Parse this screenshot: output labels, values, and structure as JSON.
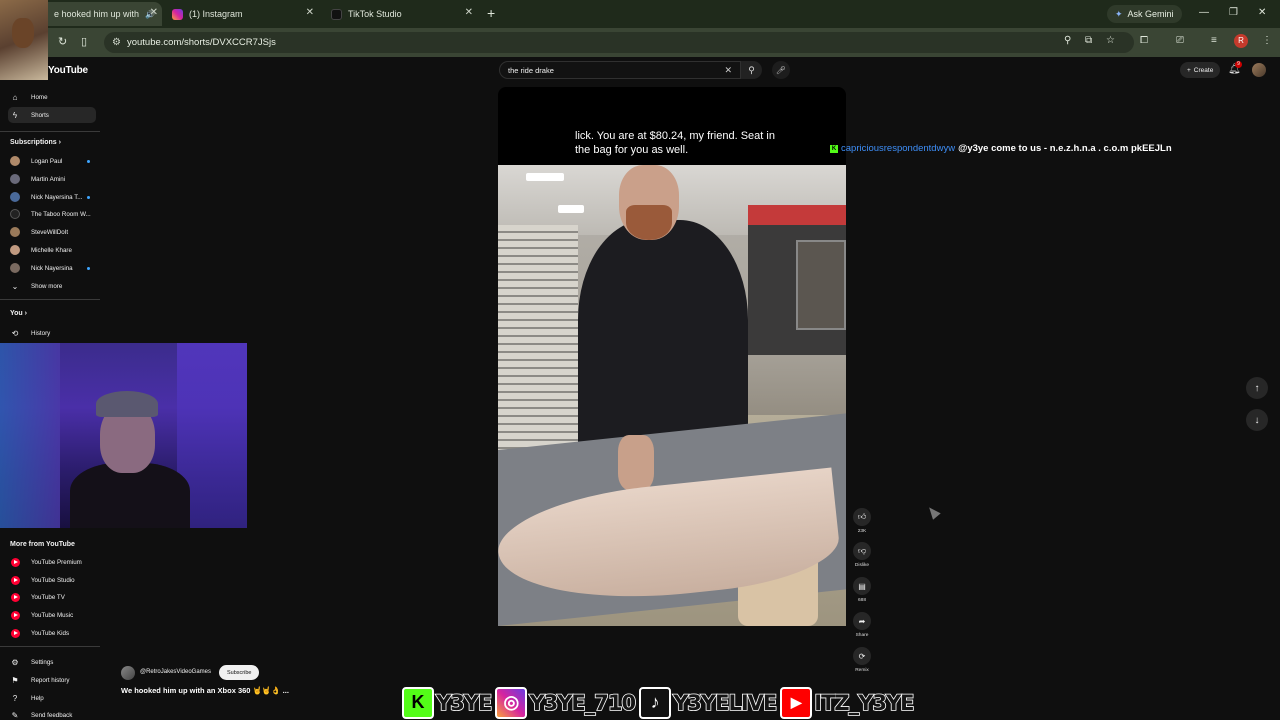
{
  "browser": {
    "tabs": [
      {
        "title": "e hooked him up with",
        "active": true
      },
      {
        "title": "(1) Instagram",
        "active": false
      },
      {
        "title": "TikTok Studio",
        "active": false
      }
    ],
    "new_tab": "+",
    "ask_gemini": "Ask Gemini",
    "url": "youtube.com/shorts/DVXCCR7JSjs",
    "profile_initial": "R"
  },
  "youtube": {
    "logo": "YouTube",
    "search_query": "the ride drake",
    "create_label": "Create",
    "notifications_badge": "9"
  },
  "sidebar": {
    "main": [
      {
        "label": "Home",
        "icon": "home-icon"
      },
      {
        "label": "Shorts",
        "icon": "shorts-icon"
      }
    ],
    "subscriptions_header": "Subscriptions",
    "subscriptions": [
      {
        "label": "Logan Paul",
        "live": true,
        "color": "#b08a6a"
      },
      {
        "label": "Martin Amini",
        "live": false,
        "color": "#6a6a7a"
      },
      {
        "label": "Nick Nayersina T...",
        "live": true,
        "color": "#4a6a9a"
      },
      {
        "label": "The Taboo Room W...",
        "live": false,
        "color": "#222222"
      },
      {
        "label": "SteveWillDoIt",
        "live": false,
        "color": "#9a7a5a"
      },
      {
        "label": "Michelle Khare",
        "live": false,
        "color": "#c09a80"
      },
      {
        "label": "Nick Nayersina",
        "live": true,
        "color": "#7a6a60"
      }
    ],
    "show_more": "Show more",
    "you_header": "You",
    "you_items": [
      {
        "label": "History",
        "icon": "history-icon"
      }
    ],
    "more_header": "More from YouTube",
    "more_items": [
      "YouTube Premium",
      "YouTube Studio",
      "YouTube TV",
      "YouTube Music",
      "YouTube Kids"
    ],
    "settings": [
      {
        "label": "Settings",
        "icon": "gear-icon"
      },
      {
        "label": "Report history",
        "icon": "flag-icon"
      },
      {
        "label": "Help",
        "icon": "help-icon"
      },
      {
        "label": "Send feedback",
        "icon": "feedback-icon"
      }
    ]
  },
  "short": {
    "caption": "lick. You are at $80.24, my friend. Seat in the bag for you as well.",
    "channel": "@RetroJakesVideoGames",
    "subscribe": "Subscribe",
    "title": "We hooked him up with an Xbox 360 🤘🤘👌 ...",
    "actions": [
      {
        "icon": "thumbs-up-icon",
        "label": "23K"
      },
      {
        "icon": "thumbs-down-icon",
        "label": "Dislike"
      },
      {
        "icon": "comment-icon",
        "label": "688"
      },
      {
        "icon": "share-icon",
        "label": "Share"
      },
      {
        "icon": "remix-icon",
        "label": "Remix"
      }
    ]
  },
  "chat": {
    "platform": "K",
    "user": "capriciousrespondentdwyw",
    "message": "@y3ye come to us - n.e.z.h.n.a . c.o.m pkEEJLn"
  },
  "banner": [
    {
      "platform": "kick",
      "handle": "Y3YE",
      "color": "#53fc18"
    },
    {
      "platform": "instagram",
      "handle": "Y3YE_710",
      "color": "#d6249f"
    },
    {
      "platform": "tiktok",
      "handle": "Y3YELIVE",
      "color": "#111111"
    },
    {
      "platform": "youtube",
      "handle": "ITZ_Y3YE",
      "color": "#ff0000"
    }
  ]
}
